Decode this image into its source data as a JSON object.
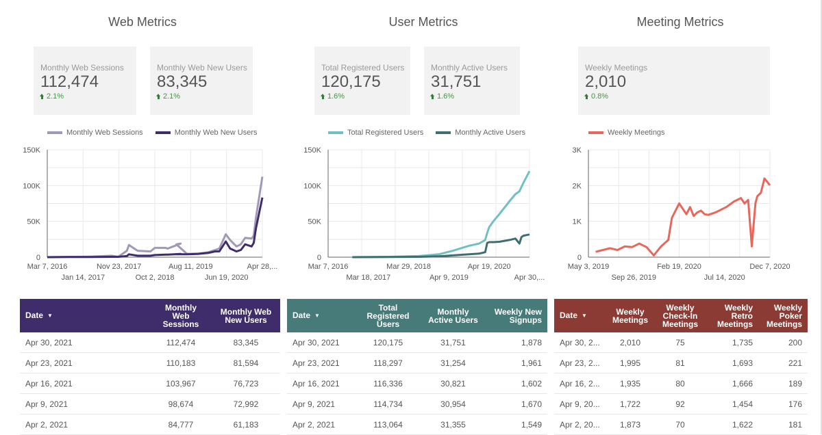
{
  "sections": [
    {
      "title": "Web Metrics",
      "kpis": [
        {
          "label": "Monthly Web Sessions",
          "value": "112,474",
          "delta": "2.1%"
        },
        {
          "label": "Monthly Web New Users",
          "value": "83,345",
          "delta": "2.1%"
        }
      ],
      "table": {
        "header_color": "#3f2d6b",
        "columns": [
          "Date",
          "Monthly Web Sessions",
          "Monthly Web New Users"
        ],
        "rows": [
          [
            "Apr 30, 2021",
            "112,474",
            "83,345"
          ],
          [
            "Apr 23, 2021",
            "110,183",
            "81,594"
          ],
          [
            "Apr 16, 2021",
            "103,967",
            "76,723"
          ],
          [
            "Apr 9, 2021",
            "98,674",
            "72,992"
          ],
          [
            "Apr 2, 2021",
            "84,777",
            "61,183"
          ]
        ]
      }
    },
    {
      "title": "User Metrics",
      "kpis": [
        {
          "label": "Total Registered Users",
          "value": "120,175",
          "delta": "1.6%"
        },
        {
          "label": "Monthly Active Users",
          "value": "31,751",
          "delta": "1.6%"
        }
      ],
      "table": {
        "header_color": "#467b79",
        "columns": [
          "Date",
          "Total Registered Users",
          "Monthly Active Users",
          "Weekly New Signups"
        ],
        "rows": [
          [
            "Apr 30, 2021",
            "120,175",
            "31,751",
            "1,878"
          ],
          [
            "Apr 23, 2021",
            "118,297",
            "31,254",
            "1,961"
          ],
          [
            "Apr 16, 2021",
            "116,336",
            "30,821",
            "1,602"
          ],
          [
            "Apr 9, 2021",
            "114,734",
            "30,954",
            "1,670"
          ],
          [
            "Apr 2, 2021",
            "113,064",
            "31,355",
            "1,549"
          ]
        ]
      }
    },
    {
      "title": "Meeting Metrics",
      "kpis": [
        {
          "label": "Weekly Meetings",
          "value": "2,010",
          "delta": "0.8%"
        }
      ],
      "table": {
        "header_color": "#8b3b33",
        "columns": [
          "Date",
          "Weekly Meetings",
          "Weekly Check-In Meetings",
          "Weekly Retro Meetings",
          "Weekly Poker Meetings"
        ],
        "rows": [
          [
            "Apr 30, 2...",
            "2,010",
            "75",
            "1,735",
            "200"
          ],
          [
            "Apr 23, 2...",
            "1,995",
            "81",
            "1,693",
            "221"
          ],
          [
            "Apr 16, 2...",
            "1,935",
            "80",
            "1,666",
            "189"
          ],
          [
            "Apr 9, 20...",
            "1,722",
            "92",
            "1,454",
            "176"
          ],
          [
            "Apr 2, 20...",
            "1,873",
            "70",
            "1,622",
            "181"
          ]
        ]
      }
    }
  ],
  "chart_data": [
    {
      "type": "line",
      "title": "",
      "xlabel": "",
      "ylabel": "",
      "ylim": [
        0,
        150000
      ],
      "yticks": [
        "0",
        "50K",
        "100K",
        "150K"
      ],
      "xticks_row1": [
        "Mar 7, 2016",
        "Nov 23, 2017",
        "Aug 11, 2019",
        "Apr 28,..."
      ],
      "xticks_row2": [
        "Jan 14, 2017",
        "Oct 2, 2018",
        "Jun 19, 2020"
      ],
      "grid": true,
      "legend": "top-center",
      "x_fraction": [
        0,
        0.1,
        0.2,
        0.3,
        0.33,
        0.37,
        0.38,
        0.42,
        0.48,
        0.5,
        0.55,
        0.56,
        0.62,
        0.6,
        0.65,
        0.7,
        0.75,
        0.78,
        0.8,
        0.83,
        0.85,
        0.88,
        0.9,
        0.92,
        0.95,
        0.96,
        0.97,
        1.0
      ],
      "series": [
        {
          "name": "Monthly Web Sessions",
          "color": "#a198b8",
          "values": [
            0,
            500,
            800,
            2000,
            500,
            9000,
            17000,
            9000,
            8000,
            13000,
            13000,
            12000,
            19000,
            18000,
            4500,
            5000,
            7000,
            10000,
            12000,
            32000,
            24000,
            15000,
            18000,
            27000,
            26000,
            30000,
            55000,
            112474
          ]
        },
        {
          "name": "Monthly Web New Users",
          "color": "#3f2d6b",
          "values": [
            0,
            200,
            300,
            500,
            500,
            1500,
            4000,
            2000,
            2000,
            3000,
            3500,
            3500,
            4500,
            4000,
            4000,
            4500,
            6000,
            8000,
            8000,
            22000,
            12000,
            8000,
            10000,
            18000,
            15000,
            20000,
            40000,
            83345
          ]
        }
      ]
    },
    {
      "type": "line",
      "title": "",
      "xlabel": "",
      "ylabel": "",
      "ylim": [
        0,
        150000
      ],
      "yticks": [
        "0",
        "50K",
        "100K",
        "150K"
      ],
      "xticks_row1": [
        "Mar 7, 2016",
        "Mar 29, 2018",
        "Apr 19, 2020"
      ],
      "xticks_row2": [
        "Mar 18, 2017",
        "Apr 9, 2019",
        "Apr 30,..."
      ],
      "grid": true,
      "legend": "top-center",
      "x_fraction": [
        0.12,
        0.3,
        0.45,
        0.55,
        0.62,
        0.7,
        0.75,
        0.78,
        0.79,
        0.8,
        0.82,
        0.85,
        0.9,
        0.93,
        0.95,
        0.96,
        0.97,
        1.0
      ],
      "series": [
        {
          "name": "Total Registered Users",
          "color": "#6fc1c1",
          "values": [
            0,
            500,
            1500,
            4000,
            9000,
            16000,
            19000,
            24000,
            34000,
            42000,
            50000,
            60000,
            78000,
            88000,
            92000,
            98000,
            104000,
            120175
          ]
        },
        {
          "name": "Monthly Active Users",
          "color": "#3f6d70",
          "values": [
            0,
            200,
            500,
            1200,
            2500,
            4000,
            5000,
            7000,
            20000,
            21000,
            21000,
            21500,
            24000,
            26000,
            19000,
            28000,
            30000,
            31751
          ]
        }
      ]
    },
    {
      "type": "line",
      "title": "",
      "xlabel": "",
      "ylabel": "",
      "ylim": [
        0,
        3000
      ],
      "yticks": [
        "0",
        "1K",
        "2K",
        "3K"
      ],
      "xticks_row1": [
        "May 3, 2019",
        "Feb 19, 2020",
        "Dec 7, 2020"
      ],
      "xticks_row2": [
        "Sep 26, 2019",
        "Jul 14, 2020"
      ],
      "grid": true,
      "legend": "top-left",
      "x_fraction": [
        0.04,
        0.08,
        0.12,
        0.16,
        0.2,
        0.24,
        0.28,
        0.32,
        0.36,
        0.4,
        0.44,
        0.46,
        0.5,
        0.54,
        0.56,
        0.58,
        0.6,
        0.62,
        0.64,
        0.66,
        0.7,
        0.74,
        0.76,
        0.8,
        0.84,
        0.86,
        0.88,
        0.9,
        0.92,
        0.93,
        0.95,
        0.97,
        1.0
      ],
      "series": [
        {
          "name": "Weekly Meetings",
          "color": "#e8675a",
          "values": [
            150,
            200,
            250,
            200,
            300,
            280,
            380,
            280,
            50,
            300,
            480,
            1100,
            1500,
            1200,
            1400,
            1150,
            1250,
            1300,
            1200,
            1180,
            1250,
            1350,
            1400,
            1550,
            1650,
            1500,
            1600,
            300,
            1500,
            1700,
            1800,
            2200,
            2010
          ]
        }
      ]
    }
  ]
}
